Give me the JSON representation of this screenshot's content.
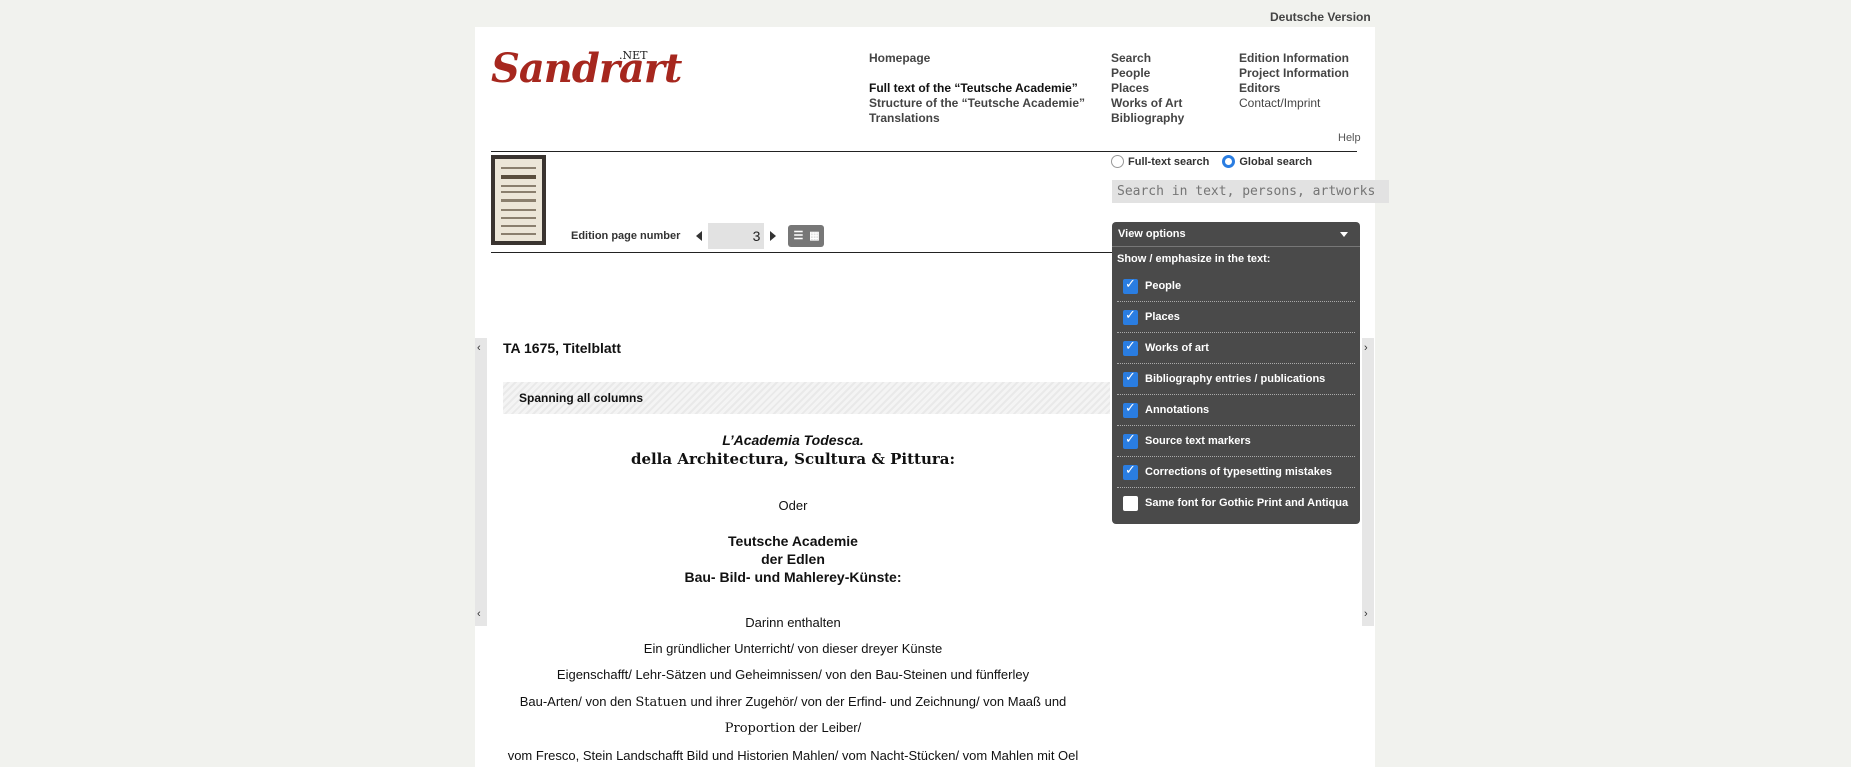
{
  "lang_switch": "Deutsche Version",
  "logo": {
    "word": "Sandrart",
    "suffix": ".NET"
  },
  "nav": {
    "col1": [
      "Homepage"
    ],
    "col1b": [
      "Full text of the “Teutsche Academie”",
      "Structure of the “Teutsche Academie”",
      "Translations"
    ],
    "col2": [
      "Search",
      "People",
      "Places",
      "Works of Art",
      "Bibliography"
    ],
    "col3": [
      "Edition Information",
      "Project Information",
      "Editors",
      "Contact/Imprint"
    ]
  },
  "page_nav": {
    "label": "Edition page number",
    "value": "3"
  },
  "search": {
    "option_fulltext": "Full-text search",
    "option_global": "Global search",
    "selected": "Global search",
    "help": "Help",
    "placeholder": "Search in text, persons, artworks"
  },
  "view_options": {
    "title": "View options",
    "subtitle": "Show / emphasize in the text:",
    "items": [
      {
        "label": "People",
        "checked": true
      },
      {
        "label": "Places",
        "checked": true
      },
      {
        "label": "Works of art",
        "checked": true
      },
      {
        "label": "Bibliography entries / publications",
        "checked": true
      },
      {
        "label": "Annotations",
        "checked": true
      },
      {
        "label": "Source text markers",
        "checked": true
      },
      {
        "label": "Corrections of typesetting mistakes",
        "checked": true
      },
      {
        "label": "Same font for Gothic Print and Antiqua",
        "checked": false
      }
    ]
  },
  "side_arrows": {
    "left": "‹",
    "right": "›"
  },
  "content": {
    "section_title": "TA 1675, Titelblatt",
    "span_label": "Spanning all columns",
    "line1": "L’Academia Todesca.",
    "line2": "della Architectura, Scultura & Pittura:",
    "line3": "Oder",
    "line4": "Teutsche Academie",
    "line5": "der Edlen",
    "line6": "Bau- Bild- und Mahlerey-Künste:",
    "line7": "Darinn enthalten",
    "line8": "Ein gründlicher Unterricht/ von dieser dreyer Künste",
    "line9": "Eigenschafft/ Lehr-Sätzen und Geheimnissen/ von den Bau-Steinen und fünfferley",
    "line10a": "Bau-Arten/ von den ",
    "line10b": "Statuen",
    "line10c": " und ihrer Zugehör/ von der Erfind- und Zeichnung/ von Maaß und",
    "line11a": "Proportion",
    "line11b": " der Leiber/",
    "line12": "vom Fresco, Stein Landschafft Bild und Historien Mahlen/ vom Nacht-Stücken/ vom Mahlen mit Oel"
  },
  "colors": {
    "accent": "#2a7de1",
    "logo_red": "#a6271e",
    "panel_bg": "#4a4a4a"
  }
}
